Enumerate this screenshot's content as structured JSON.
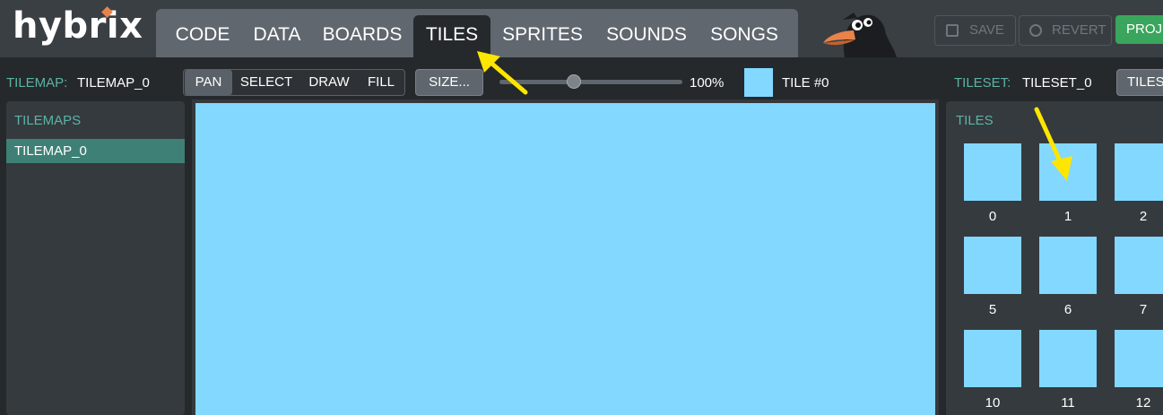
{
  "app": {
    "logo": "hybrix"
  },
  "tabs": [
    {
      "label": "CODE",
      "active": false
    },
    {
      "label": "DATA",
      "active": false
    },
    {
      "label": "BOARDS",
      "active": false
    },
    {
      "label": "TILES",
      "active": true
    },
    {
      "label": "SPRITES",
      "active": false
    },
    {
      "label": "SOUNDS",
      "active": false
    },
    {
      "label": "SONGS",
      "active": false
    }
  ],
  "header_buttons": {
    "save": "SAVE",
    "revert": "REVERT",
    "project": "PROJ"
  },
  "toolbar": {
    "tilemap_label": "TILEMAP:",
    "tilemap_value": "TILEMAP_0",
    "tools": [
      {
        "label": "PAN",
        "active": true
      },
      {
        "label": "SELECT",
        "active": false
      },
      {
        "label": "DRAW",
        "active": false
      },
      {
        "label": "FILL",
        "active": false
      }
    ],
    "size_button": "SIZE...",
    "zoom": "100%",
    "zoom_fraction": 0.37,
    "current_tile": "TILE #0",
    "tileset_label": "TILESET:",
    "tileset_value": "TILESET_0",
    "tiles_button": "TILES"
  },
  "left_panel": {
    "heading": "TILEMAPS",
    "items": [
      "TILEMAP_0"
    ]
  },
  "right_panel": {
    "heading": "TILES",
    "tiles": [
      "0",
      "1",
      "2",
      "5",
      "6",
      "7",
      "10",
      "11",
      "12"
    ]
  },
  "colors": {
    "tile_color": "#82d8ff",
    "accent_teal": "#5cb3a7",
    "project_green": "#3aa55c",
    "annotation_arrow": "#ffe600"
  },
  "icons": {
    "mascot": "crow-mascot-icon",
    "save": "floppy-disk-icon",
    "revert": "revert-clock-icon"
  }
}
